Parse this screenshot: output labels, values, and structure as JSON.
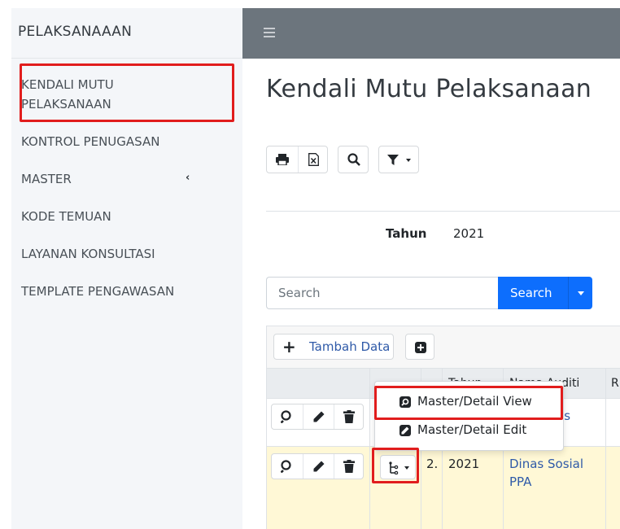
{
  "brand": {
    "title": "PELAKSANAAAN"
  },
  "sidebar": {
    "items": [
      {
        "label_line1": "KENDALI MUTU",
        "label_line2": "PELAKSANAAN",
        "active": true
      },
      {
        "label": "KONTROL PENUGASAN"
      },
      {
        "label": "MASTER",
        "has_children": true
      },
      {
        "label": "KODE TEMUAN"
      },
      {
        "label": "LAYANAN KONSULTASI"
      },
      {
        "label": "TEMPLATE PENGAWASAN"
      }
    ]
  },
  "topbar": {
    "menu_icon": "hamburger-icon"
  },
  "page": {
    "title": "Kendali Mutu Pelaksanaan",
    "toolbar": [
      "print-icon",
      "excel-export-icon",
      "search-icon",
      "filter-icon"
    ]
  },
  "filter": {
    "tahun_label": "Tahun",
    "tahun_value": "2021"
  },
  "search": {
    "placeholder": "Search",
    "button_label": "Search"
  },
  "grid": {
    "add_label": "Tambah Data",
    "columns": [
      "Tahun",
      "Nama Auditi",
      "R"
    ],
    "rows": [
      {
        "no": "",
        "tahun": "",
        "auditi": "as"
      },
      {
        "no": "2.",
        "tahun": "2021",
        "auditi_line1": "Dinas Sosial",
        "auditi_line2": "PPA"
      }
    ]
  },
  "dropdown": {
    "items": [
      {
        "label": "Master/Detail View",
        "icon": "view-icon"
      },
      {
        "label": "Master/Detail Edit",
        "icon": "edit-icon"
      }
    ]
  },
  "colors": {
    "highlight": "#e11d1d",
    "primary": "#0d6efd",
    "topbar": "#6c757d",
    "sidebar_bg": "#f4f6f9",
    "row_highlight": "#fff8d6"
  }
}
